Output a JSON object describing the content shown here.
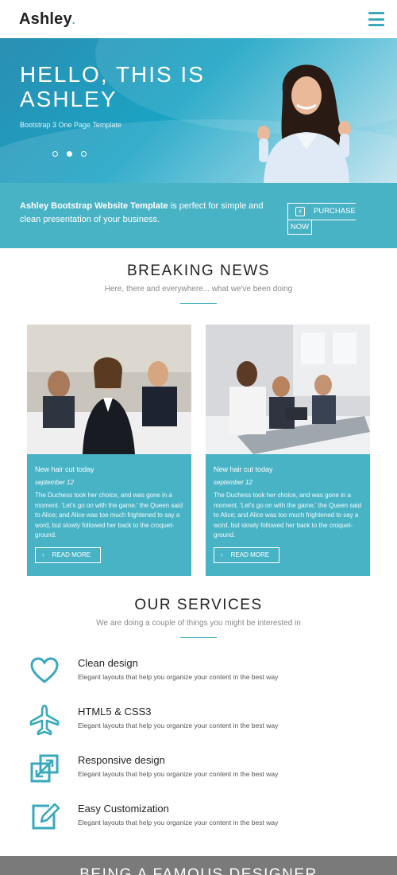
{
  "header": {
    "logo": "Ashley",
    "logo_dot": "."
  },
  "hero": {
    "title": "HELLO, THIS IS ASHLEY",
    "subtitle": "Bootstrap 3 One Page Template",
    "slides": 3,
    "active_slide": 2
  },
  "band": {
    "bold_text": "Ashley Bootstrap Website Template",
    "text": " is perfect for simple and clean presentation of your business.",
    "button_label_1": "PURCHASE",
    "button_label_2": "NOW",
    "button_icon": "bolt-icon"
  },
  "news": {
    "title": "BREAKING NEWS",
    "subtitle": "Here, there and everywhere... what we've been doing",
    "cards": [
      {
        "title": "New hair cut today",
        "date": "september 12",
        "text": "The Duchess took her choice, and was gone in a moment. 'Let's go on with the game,' the Queen said to Alice; and Alice was too much frightened to say a word, but slowly followed her back to the croquet-ground.",
        "button": "READ MORE"
      },
      {
        "title": "New hair cut today",
        "date": "september 12",
        "text": "The Duchess took her choice, and was gone in a moment. 'Let's go on with the game,' the Queen said to Alice; and Alice was too much frightened to say a word, but slowly followed her back to the croquet-ground.",
        "button": "READ MORE"
      }
    ]
  },
  "services": {
    "title": "OUR SERVICES",
    "subtitle": "We are doing a couple of things you might be interested in",
    "items": [
      {
        "icon": "heart-icon",
        "title": "Clean design",
        "desc": "Elegant layouts that help you organize your content in the best way"
      },
      {
        "icon": "plane-icon",
        "title": "HTML5 & CSS3",
        "desc": "Elegant layouts that help you organize your content in the best way"
      },
      {
        "icon": "resize-icon",
        "title": "Responsive design",
        "desc": "Elegant layouts that help you organize your content in the best way"
      },
      {
        "icon": "edit-icon",
        "title": "Easy Customization",
        "desc": "Elegant layouts that help you organize your content in the best way"
      }
    ]
  },
  "bottom": {
    "title": "BEING A FAMOUS DESIGNER"
  },
  "colors": {
    "accent": "#49b3c6",
    "hero": "#1aa3c4",
    "bottom": "#7a7a7a"
  }
}
